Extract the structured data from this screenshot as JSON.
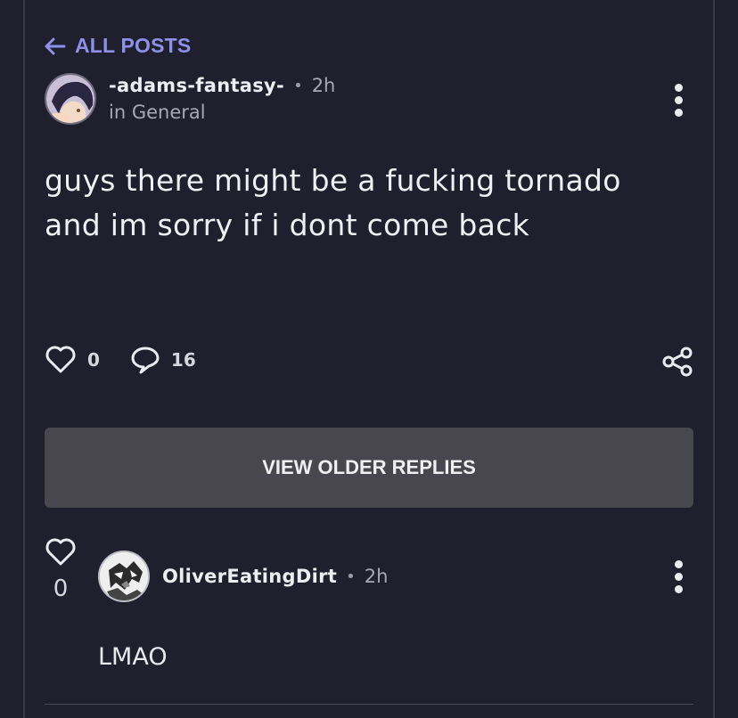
{
  "nav": {
    "back_label": "ALL POSTS"
  },
  "post": {
    "author": "-adams-fantasy-",
    "separator": "•",
    "time": "2h",
    "community": "in General",
    "body_line1": "guys there might be a fucking tornado",
    "body_line2": "and im sorry if i dont come back",
    "likes": "0",
    "comments": "16"
  },
  "older_replies": {
    "label": "VIEW OLDER REPLIES"
  },
  "reply": {
    "author": "OliverEatingDirt",
    "separator": "•",
    "time": "2h",
    "likes": "0",
    "text": "LMAO"
  },
  "colors": {
    "background": "#201f2d",
    "accent": "#8e90ea",
    "button": "#48474f"
  }
}
